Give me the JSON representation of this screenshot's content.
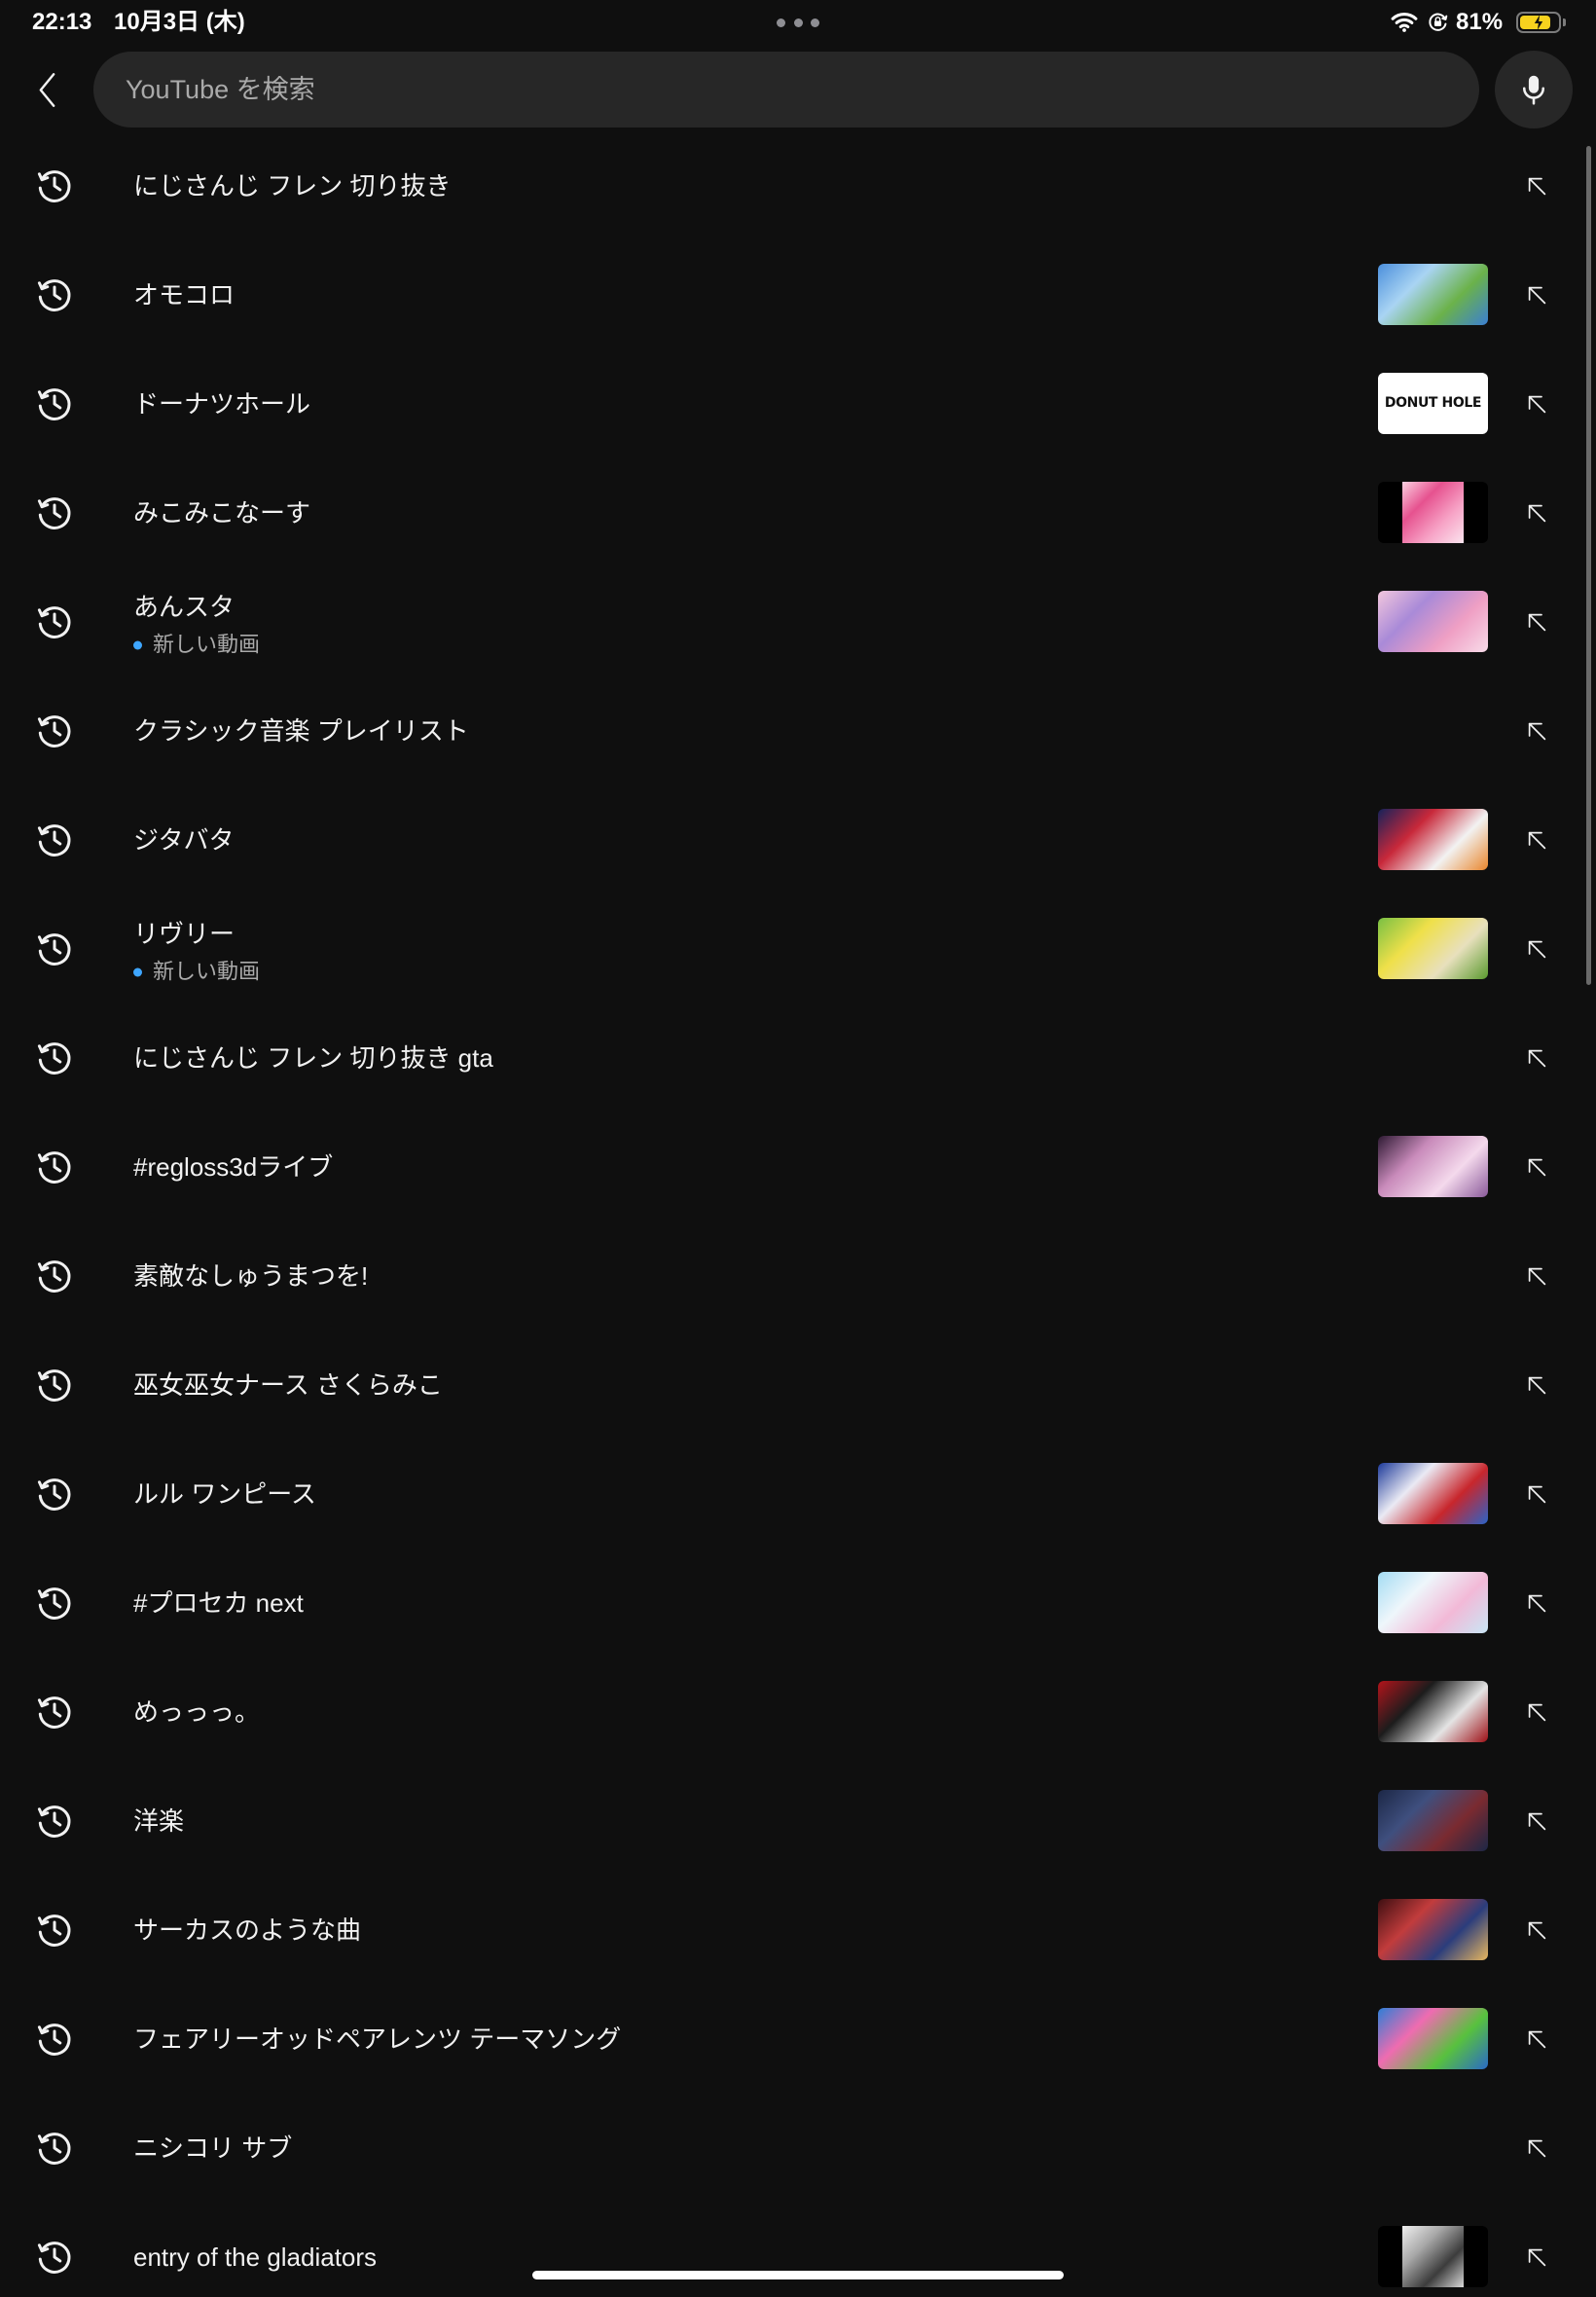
{
  "status_bar": {
    "time": "22:13",
    "date": "10月3日 (木)",
    "battery_text": "81%",
    "battery_level": 0.81,
    "charging": true
  },
  "header": {
    "search_placeholder": "YouTube を検索",
    "search_value": ""
  },
  "icons": {
    "back": "chevron-left-icon",
    "mic": "mic-icon",
    "history": "history-icon",
    "insert_query": "arrow-up-left-icon",
    "wifi": "wifi-icon",
    "orientation_lock": "orientation-lock-icon",
    "battery": "battery-charging-icon",
    "multitasking": "more-dots-icon"
  },
  "colors": {
    "background": "#0f0f0f",
    "search_field": "#272727",
    "text_primary": "#f1f1f1",
    "text_secondary": "#aaaaaa",
    "new_indicator": "#3ea6ff",
    "battery_fill": "#f7d21e"
  },
  "history": [
    {
      "query": "にじさんじ フレン 切り抜き"
    },
    {
      "query": "オモコロ",
      "thumbnail": {
        "colors": [
          "#4b8fdc",
          "#a9d4f3",
          "#6bb24a",
          "#3b7fd3"
        ]
      }
    },
    {
      "query": "ドーナツホール",
      "thumbnail": {
        "colors": [
          "#ffffff"
        ],
        "caption": "DONUT HOLE"
      }
    },
    {
      "query": "みこみこなーす",
      "thumbnail": {
        "colors": [
          "#fbd0e2",
          "#e6528f",
          "#f7a3c6",
          "#fbe4ee"
        ],
        "pillarbox": true
      }
    },
    {
      "query": "あんスタ",
      "subtitle": "新しい動画",
      "thumbnail": {
        "colors": [
          "#f2c6dd",
          "#a98ad8",
          "#ef9fc4",
          "#f8dbe9"
        ]
      }
    },
    {
      "query": "クラシック音楽 プレイリスト"
    },
    {
      "query": "ジタバタ",
      "thumbnail": {
        "colors": [
          "#15225a",
          "#c8283a",
          "#f2f2f2",
          "#e9862c"
        ]
      }
    },
    {
      "query": "リヴリー",
      "subtitle": "新しい動画",
      "thumbnail": {
        "colors": [
          "#79c043",
          "#efe04a",
          "#e8e0bd",
          "#5a9a2e"
        ]
      }
    },
    {
      "query": "にじさんじ フレン 切り抜き gta"
    },
    {
      "query": "#regloss3dライブ",
      "thumbnail": {
        "colors": [
          "#2e1a33",
          "#c98bbb",
          "#f4d9ec",
          "#8a5a9a"
        ]
      }
    },
    {
      "query": "素敵なしゅうまつを!"
    },
    {
      "query": "巫女巫女ナース さくらみこ"
    },
    {
      "query": "ルル ワンピース",
      "thumbnail": {
        "colors": [
          "#1d3a9a",
          "#eaeaf4",
          "#c8262c",
          "#2b63c8"
        ]
      }
    },
    {
      "query": "#プロセカ next",
      "thumbnail": {
        "colors": [
          "#a3dcf3",
          "#eef6fb",
          "#f2b9d7",
          "#c9e6f5"
        ]
      }
    },
    {
      "query": "めっっっ。",
      "thumbnail": {
        "colors": [
          "#b3141b",
          "#1c1c1c",
          "#e4e4e4",
          "#9e1016"
        ]
      }
    },
    {
      "query": "洋楽",
      "thumbnail": {
        "colors": [
          "#1c2746",
          "#3f4f7e",
          "#7a2a30",
          "#1c2746"
        ]
      }
    },
    {
      "query": "サーカスのような曲",
      "thumbnail": {
        "colors": [
          "#3e0f12",
          "#c23c3c",
          "#2b3d7c",
          "#e8b75f"
        ]
      }
    },
    {
      "query": "フェアリーオッドペアレンツ テーマソング",
      "thumbnail": {
        "colors": [
          "#2d7ed6",
          "#ef6cb0",
          "#58c13e",
          "#2a6ac6"
        ]
      }
    },
    {
      "query": "ニシコリ サブ"
    },
    {
      "query": "entry of the gladiators",
      "thumbnail": {
        "colors": [
          "#f0f0f0",
          "#a8a8a8",
          "#3c3c3c",
          "#d8d8d8"
        ],
        "pillarbox": true
      }
    }
  ]
}
